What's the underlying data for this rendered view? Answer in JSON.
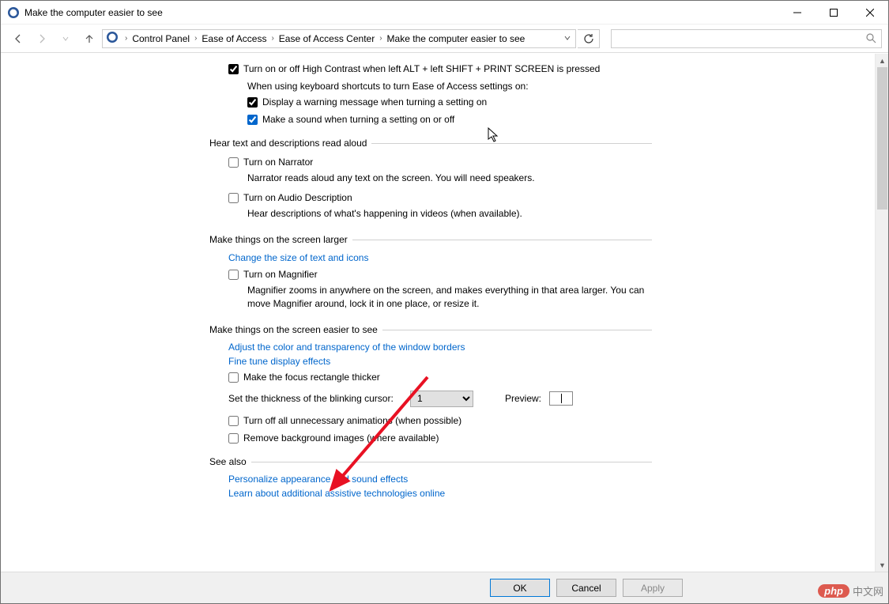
{
  "window": {
    "title": "Make the computer easier to see"
  },
  "breadcrumb": {
    "root": "Control Panel",
    "l1": "Ease of Access",
    "l2": "Ease of Access Center",
    "l3": "Make the computer easier to see"
  },
  "top": {
    "cb_highcontrast": "Turn on or off High Contrast when left ALT + left SHIFT + PRINT SCREEN is pressed",
    "sub_when": "When using keyboard shortcuts to turn Ease of Access settings on:",
    "cb_warn": "Display a warning message when turning a setting on",
    "cb_sound": "Make a sound when turning a setting on or off"
  },
  "sec1": {
    "title": "Hear text and descriptions read aloud",
    "cb_narr": "Turn on Narrator",
    "narr_desc": "Narrator reads aloud any text on the screen. You will need speakers.",
    "cb_audio": "Turn on Audio Description",
    "audio_desc": "Hear descriptions of what's happening in videos (when available)."
  },
  "sec2": {
    "title": "Make things on the screen larger",
    "link_size": "Change the size of text and icons",
    "cb_mag": "Turn on Magnifier",
    "mag_desc": "Magnifier zooms in anywhere on the screen, and makes everything in that area larger. You can move Magnifier around, lock it in one place, or resize it."
  },
  "sec3": {
    "title": "Make things on the screen easier to see",
    "link_color": "Adjust the color and transparency of the window borders",
    "link_fine": "Fine tune display effects",
    "cb_focus": "Make the focus rectangle thicker",
    "cursor_label": "Set the thickness of the blinking cursor:",
    "cursor_val": "1",
    "preview_label": "Preview:",
    "cb_anim": "Turn off all unnecessary animations (when possible)",
    "cb_bg": "Remove background images (where available)"
  },
  "seealso": {
    "title": "See also",
    "link1": "Personalize appearance and sound effects",
    "link2": "Learn about additional assistive technologies online"
  },
  "footer": {
    "ok": "OK",
    "cancel": "Cancel",
    "apply": "Apply"
  },
  "watermark": {
    "badge": "php",
    "text": "中文网"
  }
}
